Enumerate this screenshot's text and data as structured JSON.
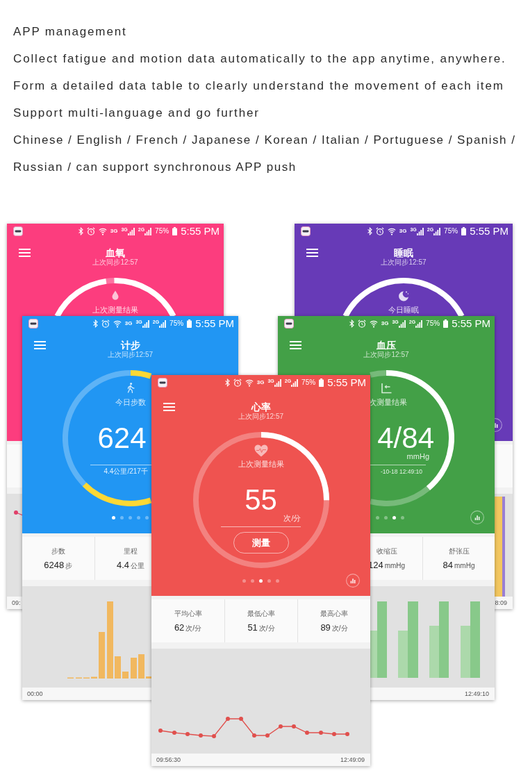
{
  "intro": {
    "heading": "APP management",
    "lines": [
      "Collect fatigue and motion data automatically to the app anytime, anywhere.",
      "Form a detailed data table to clearly understand the movement of each item",
      "Support multi-language and go further"
    ],
    "languages": "Chinese / English / French / Japanese / Korean / Italian / Portuguese / Spanish / Russian / can support synchronous APP push"
  },
  "phones": [
    {
      "kind": "oxygen",
      "color": "#fc3d7e",
      "status": {
        "network": "3G",
        "sim_1": "3G",
        "sim_2": "2G",
        "battery": "75%",
        "time": "5:55 PM"
      },
      "title": "血氧",
      "sync": "上次同步12:57",
      "ring": {
        "color": "#ffffff",
        "label": "上次测量结果"
      },
      "chart_times": {
        "start": "09:"
      }
    },
    {
      "kind": "sleep",
      "color": "#673ab7",
      "status": {
        "network": "3G",
        "sim_1": "3G",
        "sim_2": "2G",
        "battery": "75%",
        "time": "5:55 PM"
      },
      "title": "睡眠",
      "sync": "上次同步12:57",
      "ring": {
        "color": "#ffffff",
        "label": "今日睡眠"
      },
      "chart_times": {
        "end": "8:09"
      }
    },
    {
      "kind": "steps",
      "color": "#2196f3",
      "status": {
        "network": "3G",
        "sim_1": "3G",
        "sim_2": "2G",
        "battery": "75%",
        "time": "5:55 PM"
      },
      "title": "计步",
      "sync": "上次同步12:57",
      "ring": {
        "color": "#fdd835",
        "label": "今日步数",
        "value": "624",
        "detail": "4.4公里/217千"
      },
      "page_dots": [
        {
          "selected": true
        },
        {
          "selected": false
        },
        {
          "selected": false
        },
        {
          "selected": false
        },
        {
          "selected": false
        }
      ],
      "stats": [
        {
          "label": "步数",
          "value": "6248",
          "unit": "步"
        },
        {
          "label": "里程",
          "value": "4.4",
          "unit": "公里"
        }
      ],
      "chart_times": {
        "start": "00:00"
      }
    },
    {
      "kind": "pressure",
      "color": "#43a047",
      "status": {
        "network": "3G",
        "sim_1": "3G",
        "sim_2": "2G",
        "battery": "75%",
        "time": "5:55 PM"
      },
      "title": "血压",
      "sync": "上次同步12:57",
      "ring": {
        "color": "#ffffff",
        "label": "次测量结果",
        "value": "4/84",
        "unit": "mmHg",
        "detail": "-10-18 12:49:10"
      },
      "page_dots": [
        {
          "selected": false
        },
        {
          "selected": false
        },
        {
          "selected": true
        },
        {
          "selected": false
        }
      ],
      "stats": [
        {
          "label": "收缩压",
          "value": "124",
          "unit": "mmHg"
        },
        {
          "label": "舒张压",
          "value": "84",
          "unit": "mmHg"
        }
      ],
      "chart_times": {
        "end": "12:49:10"
      }
    },
    {
      "kind": "pulse",
      "color": "#ef5350",
      "status": {
        "network": "3G",
        "sim_1": "3G",
        "sim_2": "2G",
        "battery": "75%",
        "time": "5:55 PM"
      },
      "title": "心率",
      "sync": "上次同步12:57",
      "ring": {
        "level": 0.25,
        "color": "#ffffff",
        "label": "上次测量结果",
        "value": "55",
        "unit": "次/分",
        "button": "测量"
      },
      "page_dots": [
        {
          "selected": false
        },
        {
          "selected": false
        },
        {
          "selected": true
        },
        {
          "selected": false
        },
        {
          "selected": false
        }
      ],
      "stats": [
        {
          "label": "平均心率",
          "value": "62",
          "unit": "次/分"
        },
        {
          "label": "最低心率",
          "value": "51",
          "unit": "次/分"
        },
        {
          "label": "最高心率",
          "value": "89",
          "unit": "次/分"
        }
      ],
      "chart_times": {
        "start": "09:56:30",
        "end": "12:49:09"
      }
    }
  ]
}
